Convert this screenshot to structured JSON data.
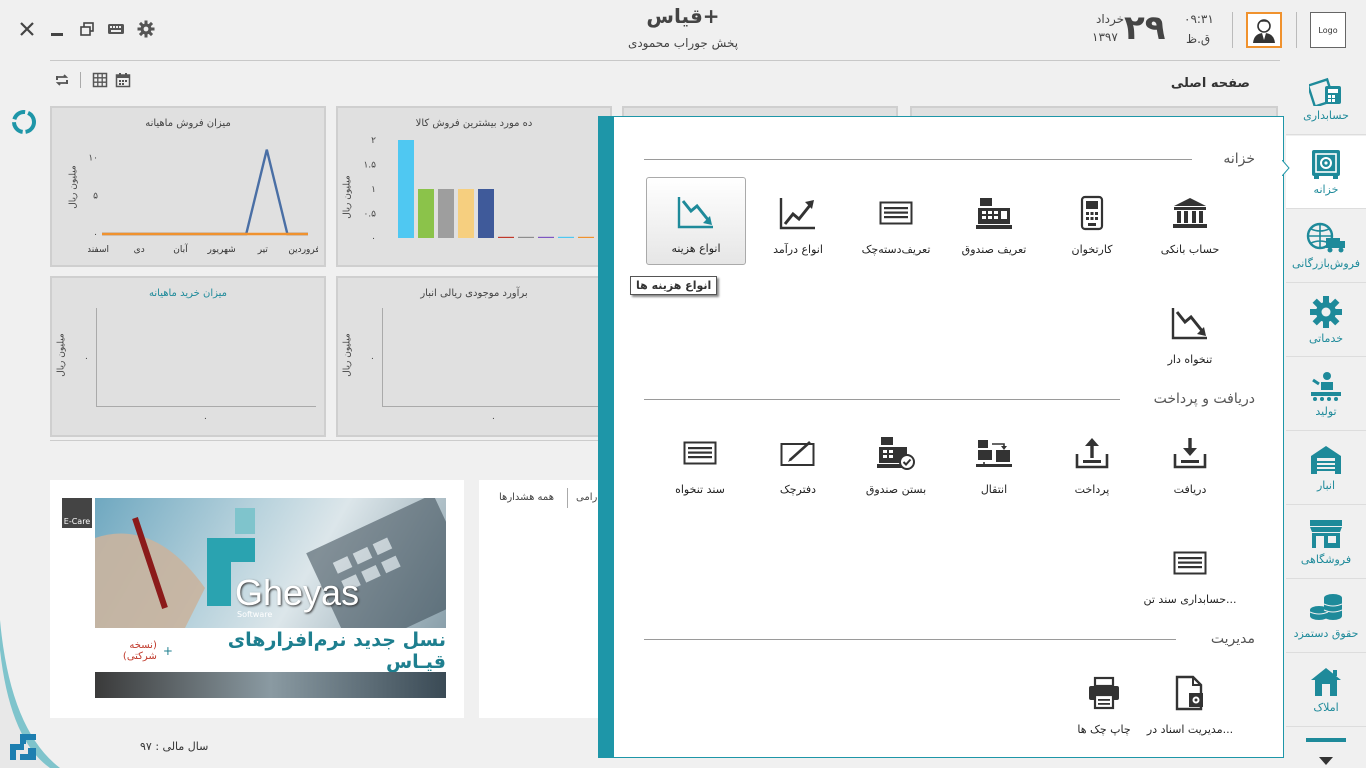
{
  "window": {
    "title": "قیاس+",
    "subtitle": "پخش جوراب محمودی"
  },
  "datetime": {
    "day": "۲۹",
    "month": "خرداد",
    "year": "۱۳۹۷",
    "time": "۰۹:۳۱",
    "ampm": "ق.ظ"
  },
  "header": {
    "logo_text": "Logo",
    "page_title": "صفحه اصلی"
  },
  "sidebar": {
    "items": [
      {
        "label": "حسابداری"
      },
      {
        "label": "خزانه"
      },
      {
        "label": "فروش‌بازرگانی"
      },
      {
        "label": "خدماتی"
      },
      {
        "label": "تولید"
      },
      {
        "label": "انبار"
      },
      {
        "label": "فروشگاهی"
      },
      {
        "label": "حقوق دستمزد"
      },
      {
        "label": "املاک"
      }
    ]
  },
  "cards": {
    "sales_monthly": {
      "title": "میزان فروش ماهیانه",
      "ylabel": "میلیون ریال",
      "yticks": [
        "۱۰",
        "۵",
        "۰"
      ],
      "xticks": [
        "اسفند",
        "دی",
        "آبان",
        "شهریور",
        "تیر",
        "فروردین"
      ]
    },
    "top_products": {
      "title": "ده مورد بیشترین فروش کالا",
      "ylabel": "میلیون ریال",
      "yticks": [
        "۲",
        "۱.۵",
        "۱",
        "۰.۵",
        "۰"
      ]
    },
    "purchase_monthly": {
      "title": "میزان خرید ماهیانه",
      "ylabel": "میلیون ریال",
      "ytick": "۰",
      "xtick": "۰"
    },
    "inventory": {
      "title": "برآورد موجودی ریالی انبار",
      "ylabel": "میلیون ریال",
      "ytick": "۰",
      "xtick": "۰"
    }
  },
  "chart_data": [
    {
      "type": "line",
      "title": "میزان فروش ماهیانه",
      "ylabel": "میلیون ریال",
      "categories": [
        "فروردین",
        "",
        "تیر",
        "",
        "شهریور",
        "",
        "آبان",
        "",
        "دی",
        "",
        "اسفند"
      ],
      "series": [
        {
          "values": [
            0,
            0,
            11,
            0,
            0,
            0,
            0,
            0,
            0,
            0,
            0
          ],
          "color": "#4a6fa5"
        },
        {
          "values": [
            0,
            0,
            0,
            0,
            0,
            0,
            0,
            0,
            0,
            0,
            0
          ],
          "color": "#f0922e"
        }
      ],
      "ylim": [
        0,
        12
      ]
    },
    {
      "type": "bar",
      "title": "ده مورد بیشترین فروش کالا",
      "ylabel": "میلیون ریال",
      "values": [
        2,
        1,
        1,
        1,
        1,
        0,
        0,
        0,
        0,
        0
      ],
      "colors": [
        "#4fc8f2",
        "#8bc34a",
        "#9e9e9e",
        "#f6cf7f",
        "#3f5a9a",
        "#c0392b",
        "#8e8e8e",
        "#7e57c2",
        "#4fc8f2",
        "#f0922e"
      ],
      "ylim": [
        0,
        2
      ]
    },
    {
      "type": "line",
      "title": "میزان خرید ماهیانه",
      "ylabel": "میلیون ریال",
      "series": []
    },
    {
      "type": "line",
      "title": "برآورد موجودی ریالی انبار",
      "ylabel": "میلیون ریال",
      "series": []
    }
  ],
  "alerts": {
    "tab_all": "همه هشدارها",
    "tab_other": "رامی"
  },
  "banner": {
    "badge": "E-Care",
    "brand": "Gheyas",
    "brand_sub": "Software",
    "slogan": "نسل جدید نرم‌افزارهای قیـاس",
    "slogan_sup": "+",
    "slogan_note": "(نسخه شرکتی)"
  },
  "footer": {
    "fiscal_year": "سال مالی : ۹۷"
  },
  "popup": {
    "sections": {
      "treasury": "خزانه",
      "receive_pay": "دریافت و پرداخت",
      "management": "مدیریت"
    },
    "treasury_tiles": [
      {
        "label": "حساب بانکی",
        "icon": "bank-icon"
      },
      {
        "label": "کارتخوان",
        "icon": "pos-terminal-icon"
      },
      {
        "label": "تعریف صندوق",
        "icon": "cash-register-icon"
      },
      {
        "label": "تعریف‌دسته‌چک",
        "icon": "checkbook-icon"
      },
      {
        "label": "انواع درآمد",
        "icon": "income-chart-icon"
      },
      {
        "label": "انواع هزینه",
        "icon": "expense-chart-icon"
      },
      {
        "label": "تنخواه دار",
        "icon": "petty-cash-icon"
      }
    ],
    "receive_tiles": [
      {
        "label": "دریافت",
        "icon": "receive-icon"
      },
      {
        "label": "پرداخت",
        "icon": "pay-icon"
      },
      {
        "label": "انتقال",
        "icon": "transfer-icon"
      },
      {
        "label": "بستن صندوق",
        "icon": "close-register-icon"
      },
      {
        "label": "دفترچک",
        "icon": "check-book-edit-icon"
      },
      {
        "label": "سند تنخواه",
        "icon": "petty-voucher-icon"
      },
      {
        "label": "حسابداری سند تن...",
        "icon": "voucher-accounting-icon"
      }
    ],
    "management_tiles": [
      {
        "label": "مدیریت اسناد در...",
        "icon": "documents-management-icon"
      },
      {
        "label": "چاپ چک ها",
        "icon": "print-check-icon"
      }
    ],
    "tooltip": "انواع هزینه ها"
  }
}
